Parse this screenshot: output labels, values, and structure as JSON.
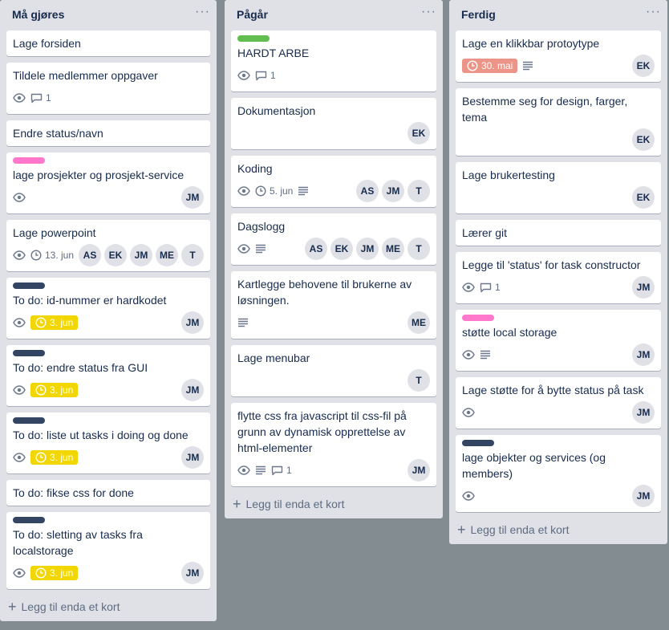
{
  "colors": {
    "label_pink": "#ff78cb",
    "label_green": "#61bd4f",
    "label_navy": "#344563",
    "due_yellow": "#f2d600",
    "due_red": "#ec9488",
    "board_bg": "#838c91",
    "list_bg": "#dfe1e6"
  },
  "add_card_label": "Legg til enda et kort",
  "lists": [
    {
      "title": "Må gjøres",
      "menu": "···",
      "cards": [
        {
          "title": "Lage forsiden"
        },
        {
          "title": "Tildele medlemmer oppgaver",
          "badges": [
            {
              "icon": "eye-icon"
            },
            {
              "icon": "comment-icon",
              "text": "1"
            }
          ]
        },
        {
          "title": "Endre status/navn"
        },
        {
          "title": "lage prosjekter og prosjekt-service",
          "label": "pink",
          "badges": [
            {
              "icon": "eye-icon"
            }
          ],
          "members": [
            "JM"
          ]
        },
        {
          "title": "Lage powerpoint",
          "badges": [
            {
              "icon": "eye-icon"
            },
            {
              "icon": "clock-icon",
              "text": "13. jun"
            }
          ],
          "members": [
            "AS",
            "EK",
            "JM",
            "ME",
            "T"
          ]
        },
        {
          "title": "To do: id-nummer er hardkodet",
          "label": "navy",
          "badges": [
            {
              "icon": "eye-icon"
            },
            {
              "icon": "clock-icon",
              "text": "3. jun",
              "style": "yellow"
            }
          ],
          "members": [
            "JM"
          ]
        },
        {
          "title": "To do: endre status fra GUI",
          "label": "navy",
          "badges": [
            {
              "icon": "eye-icon"
            },
            {
              "icon": "clock-icon",
              "text": "3. jun",
              "style": "yellow"
            }
          ],
          "members": [
            "JM"
          ]
        },
        {
          "title": "To do: liste ut tasks i doing og done",
          "label": "navy",
          "badges": [
            {
              "icon": "eye-icon"
            },
            {
              "icon": "clock-icon",
              "text": "3. jun",
              "style": "yellow"
            }
          ],
          "members": [
            "JM"
          ]
        },
        {
          "title": "To do: fikse css for done"
        },
        {
          "title": "To do: sletting av tasks fra localstorage",
          "label": "navy",
          "badges": [
            {
              "icon": "eye-icon"
            },
            {
              "icon": "clock-icon",
              "text": "3. jun",
              "style": "yellow"
            }
          ],
          "members": [
            "JM"
          ]
        }
      ]
    },
    {
      "title": "Pågår",
      "menu": "···",
      "cards": [
        {
          "title": "HARDT ARBE",
          "label": "green",
          "badges": [
            {
              "icon": "eye-icon"
            },
            {
              "icon": "comment-icon",
              "text": "1"
            }
          ]
        },
        {
          "title": "Dokumentasjon",
          "members": [
            "EK"
          ]
        },
        {
          "title": "Koding",
          "badges": [
            {
              "icon": "eye-icon"
            },
            {
              "icon": "clock-icon",
              "text": "5. jun"
            },
            {
              "icon": "description-icon"
            }
          ],
          "members": [
            "AS",
            "JM",
            "T"
          ]
        },
        {
          "title": "Dagslogg",
          "badges": [
            {
              "icon": "eye-icon"
            },
            {
              "icon": "description-icon"
            }
          ],
          "members": [
            "AS",
            "EK",
            "JM",
            "ME",
            "T"
          ]
        },
        {
          "title": "Kartlegge behovene til brukerne av løsningen.",
          "badges": [
            {
              "icon": "description-icon"
            }
          ],
          "members": [
            "ME"
          ]
        },
        {
          "title": "Lage menubar",
          "members": [
            "T"
          ]
        },
        {
          "title": "flytte css fra javascript til css-fil på grunn av dynamisk opprettelse av html-elementer",
          "badges": [
            {
              "icon": "eye-icon"
            },
            {
              "icon": "description-icon"
            },
            {
              "icon": "comment-icon",
              "text": "1"
            }
          ],
          "members": [
            "JM"
          ]
        }
      ]
    },
    {
      "title": "Ferdig",
      "menu": "···",
      "cards": [
        {
          "title": "Lage en klikkbar protoytype",
          "badges": [
            {
              "icon": "clock-icon",
              "text": "30. mai",
              "style": "red"
            },
            {
              "icon": "description-icon"
            }
          ],
          "members": [
            "EK"
          ]
        },
        {
          "title": "Bestemme seg for design, farger, tema",
          "members": [
            "EK"
          ]
        },
        {
          "title": "Lage brukertesting",
          "members": [
            "EK"
          ]
        },
        {
          "title": "Lærer git"
        },
        {
          "title": "Legge til 'status' for task constructor",
          "badges": [
            {
              "icon": "eye-icon"
            },
            {
              "icon": "comment-icon",
              "text": "1"
            }
          ],
          "members": [
            "JM"
          ]
        },
        {
          "title": "støtte local storage",
          "label": "pink",
          "badges": [
            {
              "icon": "eye-icon"
            },
            {
              "icon": "description-icon"
            }
          ],
          "members": [
            "JM"
          ]
        },
        {
          "title": "Lage støtte for å bytte status på task",
          "badges": [
            {
              "icon": "eye-icon"
            }
          ],
          "members": [
            "JM"
          ]
        },
        {
          "title": "lage objekter og services (og members)",
          "label": "navy",
          "badges": [
            {
              "icon": "eye-icon"
            }
          ],
          "members": [
            "JM"
          ]
        }
      ]
    }
  ]
}
